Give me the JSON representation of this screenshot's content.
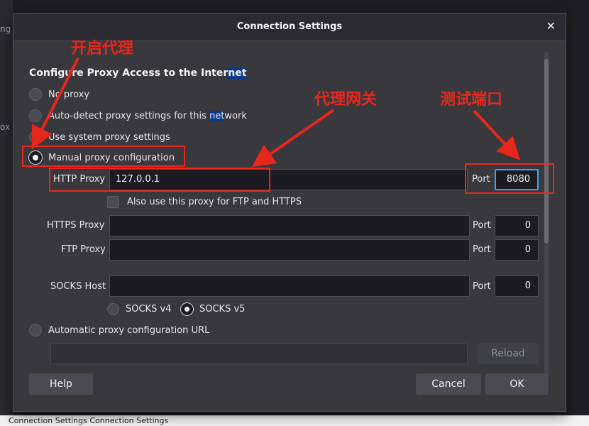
{
  "background": {
    "frag_left_1": "ng",
    "frag_left_2": "ox",
    "bottom_text": "Connection Settings Connection Settings"
  },
  "dialog": {
    "title": "Connection Settings",
    "close_icon": "close-icon",
    "heading_pre": "Configure Proxy Access to the Inter",
    "heading_hl": "net",
    "options": {
      "no_proxy": "No proxy",
      "auto_detect_pre": "Auto-detect proxy settings for this ",
      "auto_detect_hl": "net",
      "auto_detect_post": "work",
      "system": "Use system proxy settings",
      "manual": "Manual proxy configuration",
      "auto_url": "Automatic proxy configuration URL"
    },
    "selected_option": "manual",
    "http_proxy": {
      "label": "HTTP Proxy",
      "value": "127.0.0.1",
      "port_label": "Port",
      "port_value": "8080"
    },
    "also_use": "Also use this proxy for FTP and HTTPS",
    "https_proxy": {
      "label": "HTTPS Proxy",
      "value": "",
      "port_label": "Port",
      "port_value": "0"
    },
    "ftp_proxy": {
      "label": "FTP Proxy",
      "value": "",
      "port_label": "Port",
      "port_value": "0"
    },
    "socks_host": {
      "label": "SOCKS Host",
      "value": "",
      "port_label": "Port",
      "port_value": "0"
    },
    "socks_v4": "SOCKS v4",
    "socks_v5": "SOCKS v5",
    "socks_selected": "v5",
    "auto_url_value": "",
    "reload": "Reload",
    "help": "Help",
    "cancel": "Cancel",
    "ok": "OK"
  },
  "annotations": {
    "enable_proxy": "开启代理",
    "proxy_gateway": "代理网关",
    "test_port": "测试端口",
    "color": "#e8271c"
  },
  "colors": {
    "dialog_bg": "#38383d",
    "focus": "#3fa0ff",
    "highlight": "#0a3a8a"
  }
}
